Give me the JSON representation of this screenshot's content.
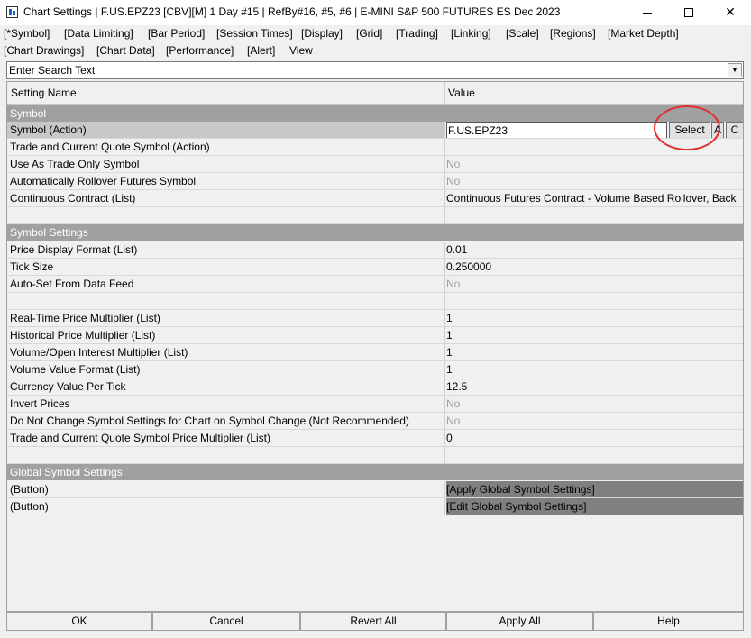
{
  "window": {
    "title": "Chart Settings | F.US.EPZ23 [CBV][M]  1 Day  #15 | RefBy#16, #5, #6 | E-MINI S&P 500 FUTURES ES Dec 2023",
    "icon": "chart-app-icon"
  },
  "menu": {
    "row1": [
      "[*Symbol]",
      "[Data Limiting]",
      "[Bar Period]",
      "[Session Times]",
      "[Display]",
      "[Grid]",
      "[Trading]",
      "[Linking]",
      "[Scale]",
      "[Regions]",
      "[Market Depth]"
    ],
    "row2": [
      "[Chart Drawings]",
      "[Chart Data]",
      "[Performance]",
      "[Alert]",
      "View"
    ]
  },
  "search": {
    "placeholder": "Enter Search Text"
  },
  "table": {
    "col_name": "Setting Name",
    "col_value": "Value",
    "sections": {
      "symbol": "Symbol",
      "symbol_settings": "Symbol Settings",
      "global": "Global Symbol Settings"
    },
    "rows": {
      "symbol_action": {
        "name": "Symbol (Action)",
        "value": "F.US.EPZ23",
        "select": "Select",
        "a": "A",
        "c": "C"
      },
      "trade_quote_symbol": {
        "name": "Trade and Current Quote Symbol (Action)",
        "value": ""
      },
      "trade_only": {
        "name": "Use As Trade Only Symbol",
        "value": "No"
      },
      "auto_rollover": {
        "name": "Automatically Rollover Futures Symbol",
        "value": "No"
      },
      "continuous": {
        "name": "Continuous Contract (List)",
        "value": "Continuous Futures Contract - Volume Based Rollover, Back"
      },
      "price_format": {
        "name": "Price Display Format (List)",
        "value": "0.01"
      },
      "tick_size": {
        "name": "Tick Size",
        "value": "0.250000"
      },
      "auto_set": {
        "name": "Auto-Set From Data Feed",
        "value": "No"
      },
      "rt_price_mult": {
        "name": "Real-Time Price Multiplier (List)",
        "value": "1"
      },
      "hist_price_mult": {
        "name": "Historical Price Multiplier (List)",
        "value": "1"
      },
      "vol_oi_mult": {
        "name": "Volume/Open Interest Multiplier (List)",
        "value": "1"
      },
      "vol_value_format": {
        "name": "Volume Value Format (List)",
        "value": "1"
      },
      "currency_tick": {
        "name": "Currency Value Per Tick",
        "value": "12.5"
      },
      "invert": {
        "name": "Invert Prices",
        "value": "No"
      },
      "no_change": {
        "name": "Do Not Change Symbol Settings for Chart on Symbol Change (Not Recommended)",
        "value": "No"
      },
      "tq_price_mult": {
        "name": "Trade and Current Quote Symbol Price Multiplier (List)",
        "value": "0"
      },
      "apply_global": {
        "name": "(Button)",
        "value": "[Apply Global Symbol Settings]"
      },
      "edit_global": {
        "name": "(Button)",
        "value": "[Edit Global Symbol Settings]"
      }
    }
  },
  "footer": {
    "ok": "OK",
    "cancel": "Cancel",
    "revert": "Revert All",
    "apply": "Apply All",
    "help": "Help"
  },
  "colors": {
    "section_header": "#a0a0a0",
    "annotation": "#e03030"
  }
}
